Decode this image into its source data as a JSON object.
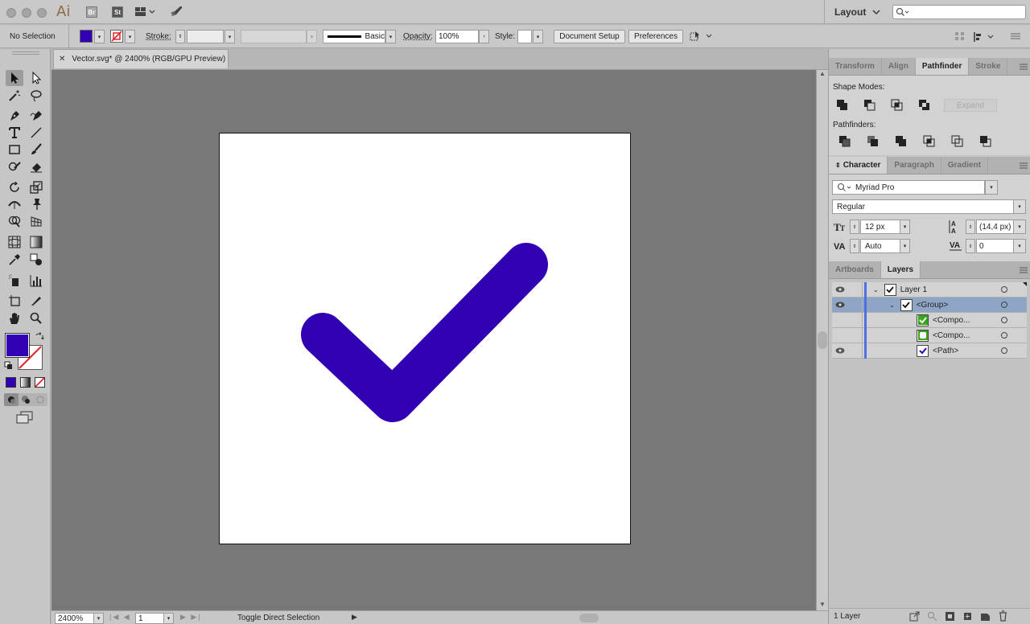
{
  "app": {
    "logo": "Ai",
    "bridge_badge": "Br",
    "stock_badge": "St",
    "workspace": "Layout"
  },
  "control_bar": {
    "selection_status": "No Selection",
    "stroke_label": "Stroke:",
    "brush_label": "Basic",
    "opacity_label": "Opacity:",
    "opacity_value": "100%",
    "style_label": "Style:",
    "document_setup": "Document Setup",
    "preferences": "Preferences"
  },
  "document": {
    "tab_title": "Vector.svg* @ 2400% (RGB/GPU Preview)",
    "zoom": "2400%",
    "artboard_number": "1",
    "status_text": "Toggle Direct Selection"
  },
  "colors": {
    "fill": "#3200b3",
    "checkmark": "#3200b3",
    "canvas": "#787878"
  },
  "pathfinder_panel": {
    "tabs": [
      "Transform",
      "Align",
      "Pathfinder",
      "Stroke"
    ],
    "active_tab": "Pathfinder",
    "shape_modes_label": "Shape Modes:",
    "expand_button": "Expand",
    "pathfinders_label": "Pathfinders:"
  },
  "character_panel": {
    "tabs": [
      "Character",
      "Paragraph",
      "Gradient"
    ],
    "font_family": "Myriad Pro",
    "font_style": "Regular",
    "font_size": "12 px",
    "leading": "(14,4 px)",
    "kerning": "Auto",
    "tracking": "0"
  },
  "layers_panel": {
    "tabs": [
      "Artboards",
      "Layers"
    ],
    "rows": [
      {
        "name": "Layer 1"
      },
      {
        "name": "<Group>"
      },
      {
        "name": "<Compo..."
      },
      {
        "name": "<Compo..."
      },
      {
        "name": "<Path>"
      }
    ],
    "footer_count": "1 Layer"
  }
}
